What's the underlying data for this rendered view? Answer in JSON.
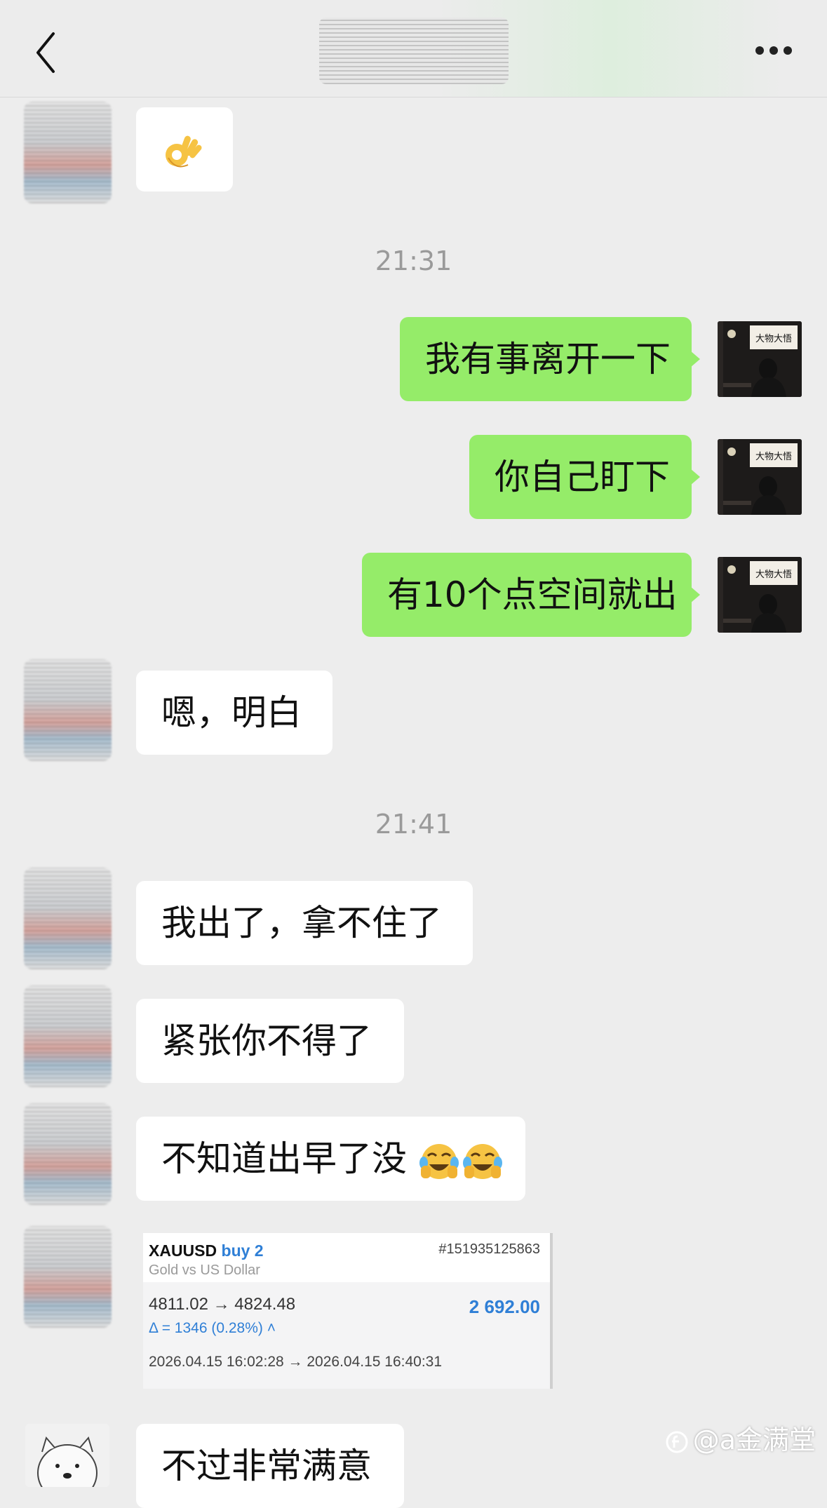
{
  "header": {
    "back_icon": "chevron-left-icon",
    "more_icon": "more-horizontal-icon"
  },
  "timestamps": [
    "21:31",
    "21:41"
  ],
  "messages": [
    {
      "side": "left",
      "emoji": "ok-hand-emoji"
    },
    {
      "side": "right",
      "text": "我有事离开一下"
    },
    {
      "side": "right",
      "text": "你自己盯下"
    },
    {
      "side": "right",
      "text": "有10个点空间就出"
    },
    {
      "side": "left",
      "text": "嗯，明白"
    },
    {
      "side": "left",
      "text": "我出了，拿不住了"
    },
    {
      "side": "left",
      "text": "紧张你不得了"
    },
    {
      "side": "left",
      "text": "不知道出早了没",
      "emoji": "face-with-tears-emoji"
    },
    {
      "side": "left",
      "text": "不过非常满意"
    }
  ],
  "avatar_sign_text": "大物大悟",
  "trade_card": {
    "symbol": "XAUUSD",
    "side": "buy 2",
    "ticket": "#151935125863",
    "description": "Gold vs US Dollar",
    "prices": "4811.02 → 4824.48",
    "profit": "2 692.00",
    "delta": "Δ = 1346 (0.28%)",
    "times": "2026.04.15 16:02:28 → 2026.04.15 16:40:31"
  },
  "watermark": "@a金满堂",
  "colors": {
    "background": "#ededed",
    "bubble_self": "#95ec69",
    "bubble_other": "#ffffff",
    "profit_blue": "#2f7fd6"
  }
}
